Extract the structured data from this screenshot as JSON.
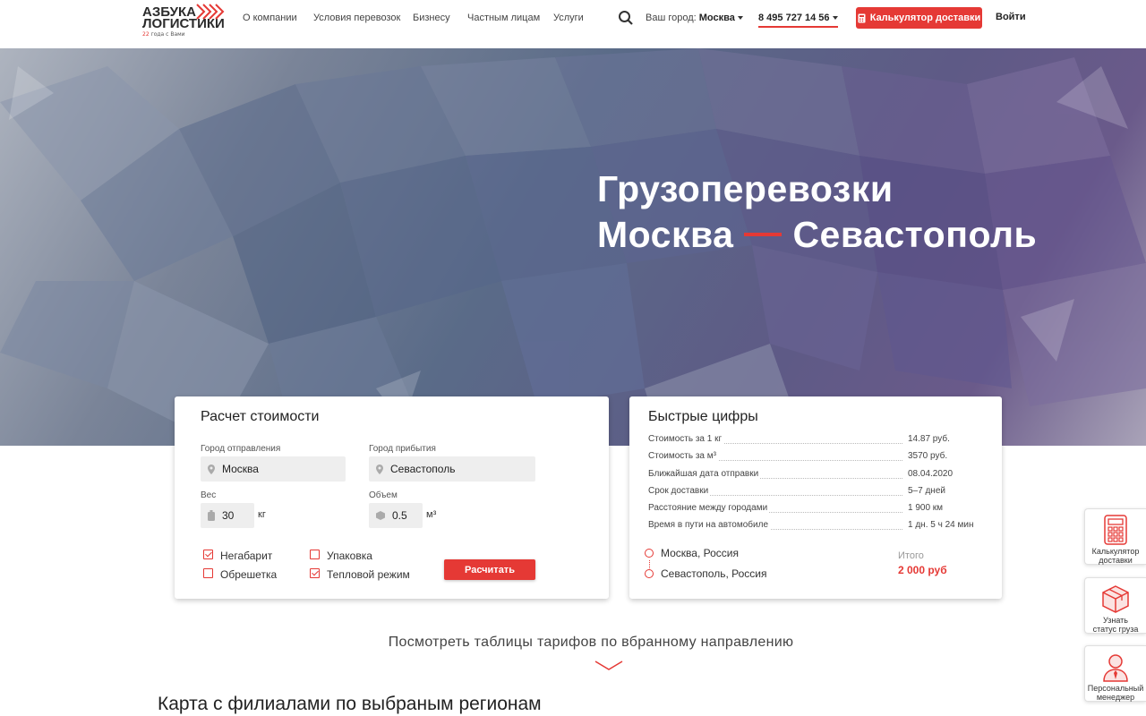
{
  "header": {
    "logo_line1": "АЗБУКА",
    "logo_line2": "ЛОГИСТИКИ",
    "logo_tag_prefix": "22",
    "logo_tag_text": "года с Вами",
    "nav": [
      "О компании",
      "Условия перевозок",
      "Бизнесу",
      "Частным лицам",
      "Услуги"
    ],
    "city_label": "Ваш город:",
    "city_value": "Москва",
    "phone": "8 495 727 14 56",
    "calc_button": "Калькулятор доставки",
    "login": "Войти"
  },
  "hero": {
    "title_line1": "Грузоперевозки",
    "from": "Москва",
    "to": "Севастополь"
  },
  "calculator": {
    "title": "Расчет стоимости",
    "from_label": "Город отправления",
    "from_value": "Москва",
    "to_label": "Город прибытия",
    "to_value": "Севастополь",
    "weight_label": "Вес",
    "weight_value": "30",
    "weight_unit": "кг",
    "volume_label": "Объем",
    "volume_value": "0.5",
    "volume_unit": "м³",
    "options": [
      {
        "label": "Негабарит",
        "checked": true
      },
      {
        "label": "Обрешетка",
        "checked": false
      },
      {
        "label": "Упаковка",
        "checked": false
      },
      {
        "label": "Тепловой режим",
        "checked": true
      }
    ],
    "submit": "Расчитать"
  },
  "facts": {
    "title": "Быстрые цифры",
    "rows": [
      {
        "label": "Стоимость за 1 кг",
        "value": "14.87 руб."
      },
      {
        "label": "Стоимость за м³",
        "value": "3570 руб."
      },
      {
        "label": "Ближайшая дата отправки",
        "value": "08.04.2020"
      },
      {
        "label": "Срок доставки",
        "value": "5–7 дней"
      },
      {
        "label": "Расстояние между городами",
        "value": "1 900 км"
      },
      {
        "label": "Время в пути на автомобиле",
        "value": "1 дн. 5 ч 24 мин"
      }
    ],
    "route_from": "Москва, Россия",
    "route_to": "Севастополь, Россия",
    "total_label": "Итого",
    "total_value": "2 000 руб"
  },
  "tariff_link": "Посмотреть таблицы тарифов по вбранному направлению",
  "map_section_title": "Карта с филиалами по выбраным регионам",
  "widgets": [
    {
      "line1": "Калькулятор",
      "line2": "доставки",
      "icon": "calculator-icon"
    },
    {
      "line1": "Узнать",
      "line2": "статус груза",
      "icon": "box-icon"
    },
    {
      "line1": "Персональный",
      "line2": "менеджер",
      "icon": "manager-icon"
    }
  ],
  "colors": {
    "accent": "#e53935",
    "text": "#222222"
  }
}
